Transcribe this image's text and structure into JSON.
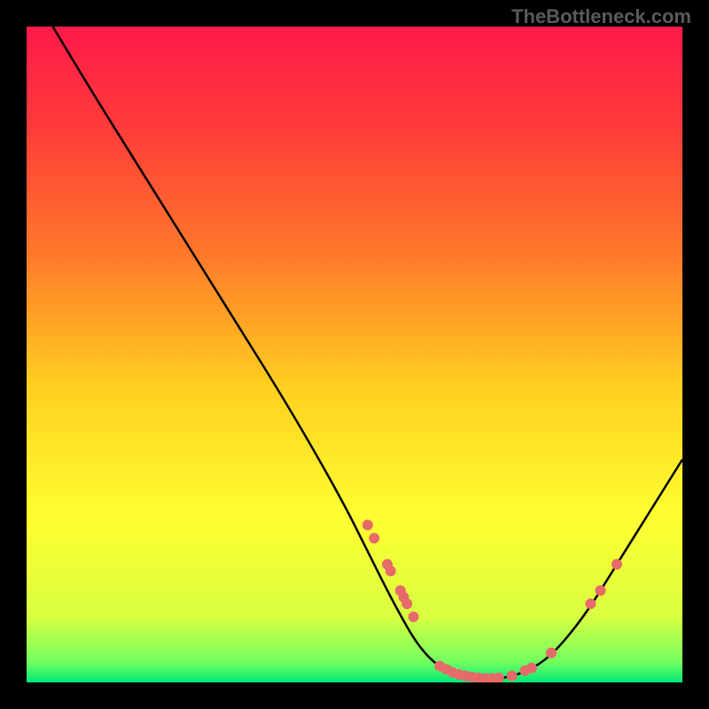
{
  "watermark": "TheBottleneck.com",
  "chart_data": {
    "type": "line",
    "title": "",
    "xlabel": "",
    "ylabel": "",
    "xlim": [
      0,
      100
    ],
    "ylim": [
      0,
      100
    ],
    "background_gradient": {
      "stops": [
        {
          "offset": 0.0,
          "color": "#ff1a4a"
        },
        {
          "offset": 0.15,
          "color": "#ff3a3a"
        },
        {
          "offset": 0.35,
          "color": "#ff7a2a"
        },
        {
          "offset": 0.55,
          "color": "#ffd020"
        },
        {
          "offset": 0.75,
          "color": "#ffff30"
        },
        {
          "offset": 0.9,
          "color": "#d8ff40"
        },
        {
          "offset": 0.97,
          "color": "#70ff60"
        },
        {
          "offset": 1.0,
          "color": "#00e878"
        }
      ]
    },
    "curve": [
      {
        "x": 4,
        "y": 100
      },
      {
        "x": 10,
        "y": 90
      },
      {
        "x": 20,
        "y": 74
      },
      {
        "x": 30,
        "y": 58
      },
      {
        "x": 40,
        "y": 42
      },
      {
        "x": 48,
        "y": 28
      },
      {
        "x": 52,
        "y": 20
      },
      {
        "x": 56,
        "y": 12
      },
      {
        "x": 60,
        "y": 5
      },
      {
        "x": 64,
        "y": 1.5
      },
      {
        "x": 68,
        "y": 0.5
      },
      {
        "x": 72,
        "y": 0.5
      },
      {
        "x": 76,
        "y": 1.5
      },
      {
        "x": 80,
        "y": 4
      },
      {
        "x": 85,
        "y": 10
      },
      {
        "x": 90,
        "y": 18
      },
      {
        "x": 95,
        "y": 26
      },
      {
        "x": 100,
        "y": 34
      }
    ],
    "markers": [
      {
        "x": 52,
        "y": 24
      },
      {
        "x": 53,
        "y": 22
      },
      {
        "x": 55,
        "y": 18
      },
      {
        "x": 55.5,
        "y": 17
      },
      {
        "x": 57,
        "y": 14
      },
      {
        "x": 57.5,
        "y": 13
      },
      {
        "x": 58,
        "y": 12
      },
      {
        "x": 59,
        "y": 10
      },
      {
        "x": 63,
        "y": 2.5
      },
      {
        "x": 64,
        "y": 2
      },
      {
        "x": 65,
        "y": 1.5
      },
      {
        "x": 66,
        "y": 1.2
      },
      {
        "x": 67,
        "y": 1
      },
      {
        "x": 68,
        "y": 0.8
      },
      {
        "x": 69,
        "y": 0.7
      },
      {
        "x": 70,
        "y": 0.6
      },
      {
        "x": 71,
        "y": 0.6
      },
      {
        "x": 72,
        "y": 0.7
      },
      {
        "x": 74,
        "y": 1
      },
      {
        "x": 76,
        "y": 1.8
      },
      {
        "x": 77,
        "y": 2.2
      },
      {
        "x": 80,
        "y": 4.5
      },
      {
        "x": 86,
        "y": 12
      },
      {
        "x": 87.5,
        "y": 14
      },
      {
        "x": 90,
        "y": 18
      }
    ],
    "marker_color": "#e66a6a",
    "curve_color": "#000000"
  }
}
